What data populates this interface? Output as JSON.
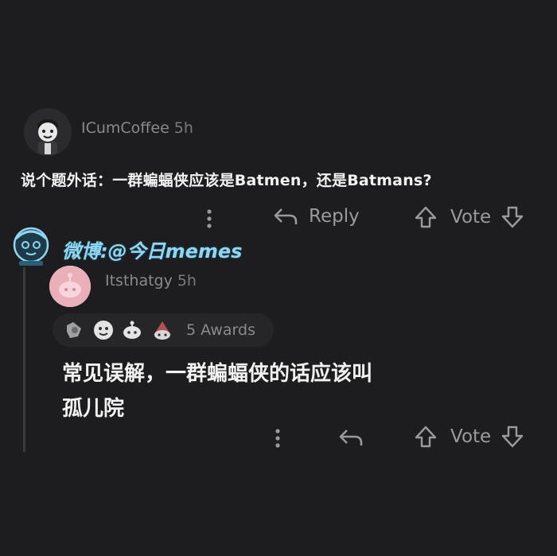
{
  "comment1": {
    "username": "ICumCoffee",
    "time": "5h",
    "body": "说个题外话：一群蝙蝠侠应该是Batmen，还是Batmans?",
    "actions": {
      "reply": "Reply",
      "vote": "Vote"
    }
  },
  "watermark": {
    "text": "微博:@今日memes"
  },
  "comment2": {
    "username": "Itsthatgy",
    "time": "5h",
    "awards": "5 Awards",
    "body_line1": "常见误解，一群蝙蝠侠的话应该叫",
    "body_line2": "孤儿院",
    "actions": {
      "vote": "Vote"
    }
  },
  "icons": [
    "avatar-cartoon-icon",
    "more-vertical-icon",
    "reply-arrow-icon",
    "upvote-arrow-icon",
    "downvote-arrow-icon",
    "snoo-avatar-icon",
    "award-icon"
  ],
  "colors": {
    "background": "#1d1d1f",
    "watermark": "#8fd7f0",
    "avatar2": "#e9a5b0"
  }
}
